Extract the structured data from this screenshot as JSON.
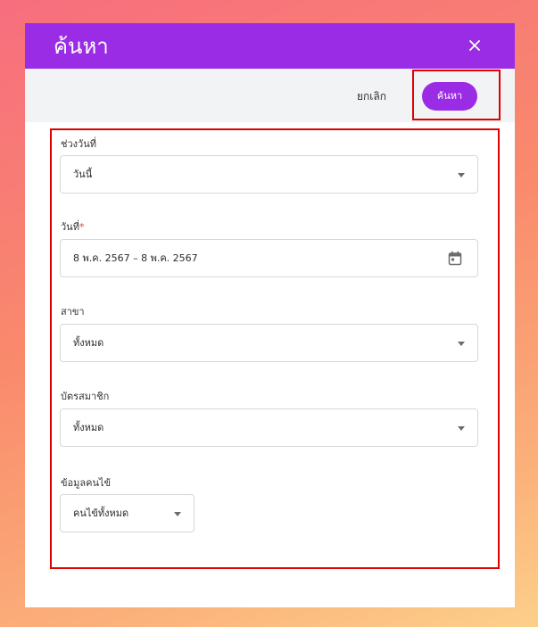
{
  "dialog": {
    "title": "ค้นหา",
    "close_icon": "close-icon"
  },
  "actions": {
    "cancel_label": "ยกเลิก",
    "search_label": "ค้นหา"
  },
  "fields": {
    "date_range": {
      "label": "ช่วงวันที่",
      "value": "วันนี้",
      "icon": "chevron-down-icon"
    },
    "date": {
      "label": "วันที่",
      "required_mark": "*",
      "value": "8 พ.ค. 2567 – 8 พ.ค. 2567",
      "icon": "calendar-icon"
    },
    "branch": {
      "label": "สาขา",
      "value": "ทั้งหมด",
      "icon": "chevron-down-icon"
    },
    "member_card": {
      "label": "บัตรสมาชิก",
      "value": "ทั้งหมด",
      "icon": "chevron-down-icon"
    },
    "patient_info": {
      "label": "ข้อมูลคนไข้",
      "value": "คนไข้ทั้งหมด",
      "icon": "chevron-down-icon"
    }
  },
  "colors": {
    "accent": "#9b2ce6",
    "highlight": "#e00000",
    "header_bar": "#f2f3f5"
  }
}
